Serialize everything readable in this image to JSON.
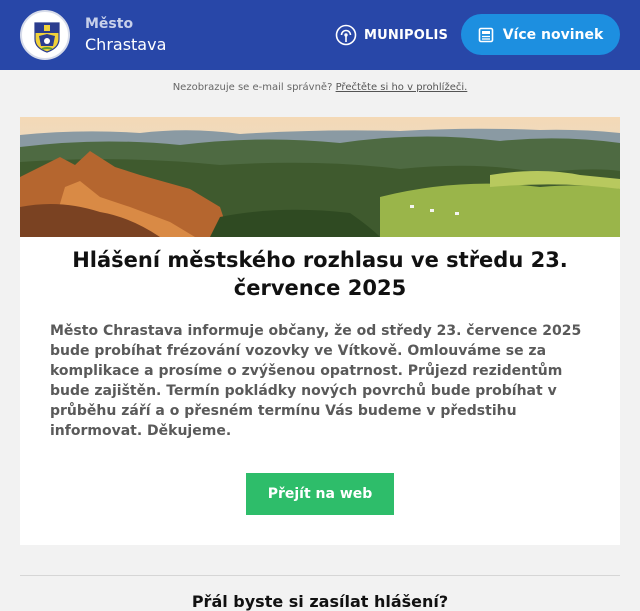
{
  "header": {
    "city_prefix": "Město",
    "city_name": "Chrastava",
    "brand": "MUNIPOLIS",
    "more_news_label": "Více novinek",
    "colors": {
      "background": "#2847a8",
      "button": "#1d8fe0"
    }
  },
  "notice": {
    "text": "Nezobrazuje se e-mail správně? ",
    "link": "Přečtěte si ho v prohlížeči."
  },
  "article": {
    "image_alt": "landscape-photo",
    "title": "Hlášení městského rozhlasu ve středu 23. července 2025",
    "body": "Město Chrastava informuje občany, že od středy 23. července 2025 bude probíhat frézování vozovky ve Vítkově. Omlouváme se za komplikace a prosíme o zvýšenou opatrnost. Průjezd rezidentům bude zajištěn. Termín pokládky nových povrchů bude probíhat v průběhu září a o přesném termínu Vás budeme v předstihu informovat. Děkujeme.",
    "cta_label": "Přejít na web",
    "cta_color": "#2ebd6a"
  },
  "footer": {
    "heading": "Přál byste si zasílat hlášení?"
  }
}
